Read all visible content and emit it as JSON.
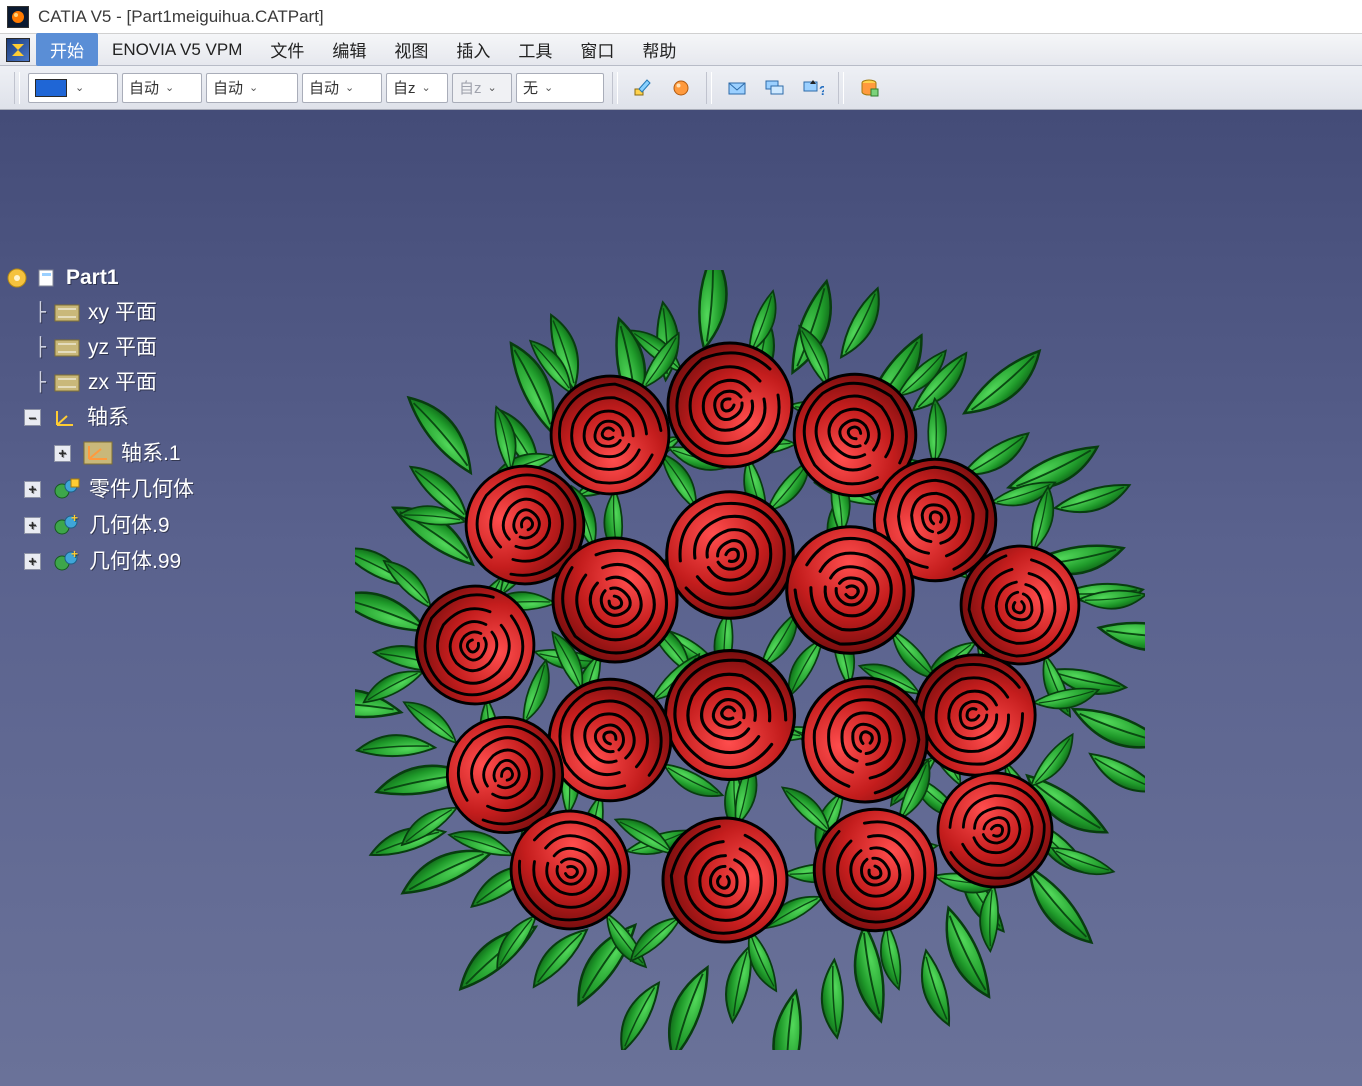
{
  "title": "CATIA V5 - [Part1meiguihua.CATPart]",
  "menubar": {
    "start": "开始",
    "items": [
      "ENOVIA V5 VPM",
      "文件",
      "编辑",
      "视图",
      "插入",
      "工具",
      "窗口",
      "帮助"
    ]
  },
  "toolbar": {
    "color_swatch": "#1f66d6",
    "combo2": "自动",
    "combo3": "自动",
    "combo4": "自动",
    "combo5": "自z",
    "combo6": "自z",
    "combo7": "无"
  },
  "tree": {
    "root": "Part1",
    "xy": "xy 平面",
    "yz": "yz 平面",
    "zx": "zx 平面",
    "axis_sys": "轴系",
    "axis_sys1": "轴系.1",
    "partbody": "零件几何体",
    "body9": "几何体.9",
    "body99": "几何体.99"
  },
  "icons": {
    "chevron": "⌄"
  }
}
